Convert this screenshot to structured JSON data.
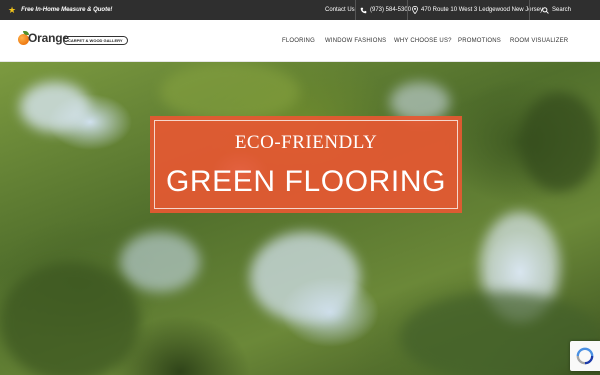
{
  "topbar": {
    "promo_icon": "star-icon",
    "promo_text": "Free In-Home Measure & Quote!",
    "contact_label": "Contact Us",
    "phone": "(973) 584-5300",
    "address": "470 Route 10 West 3 Ledgewood New Jersey",
    "search_label": "Search"
  },
  "header": {
    "logo_word": "Orange",
    "logo_badge": "CARPET & WOOD GALLERY",
    "nav": [
      "FLOORING",
      "WINDOW FASHIONS",
      "WHY CHOOSE US?",
      "PROMOTIONS",
      "ROOM VISUALIZER"
    ]
  },
  "hero": {
    "subtitle": "ECO-FRIENDLY",
    "title": "GREEN FLOORING",
    "box_color": "#e75832"
  },
  "colors": {
    "topbar_bg": "#2f2f2f",
    "accent_orange": "#ee7a12",
    "star_yellow": "#f2c41a"
  }
}
